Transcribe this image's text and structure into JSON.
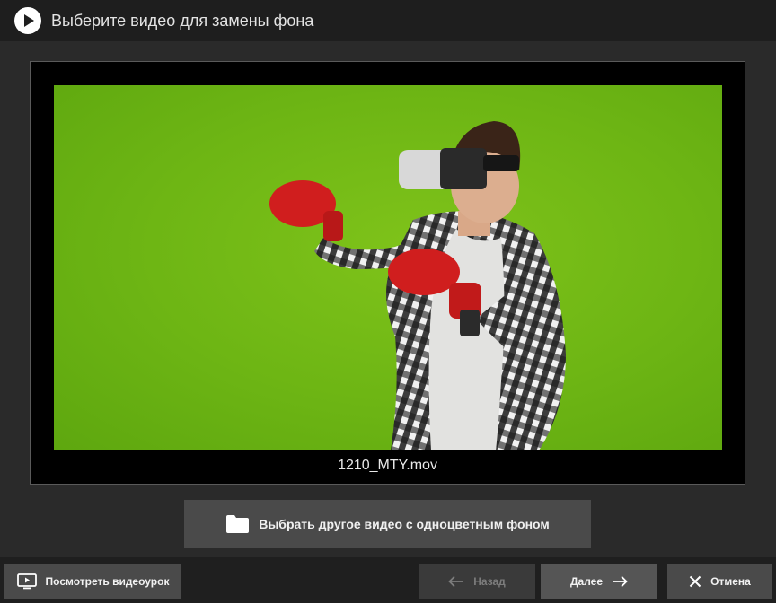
{
  "window": {
    "title": "Выберите видео для замены фона",
    "title_icon": "play-circle-icon"
  },
  "preview": {
    "filename": "1210_MTY.mov",
    "background_color": "#6db514",
    "description_icon": "chroma-key-video-frame"
  },
  "actions": {
    "choose_other_label": "Выбрать другое видео с одноцветным фоном",
    "choose_other_icon": "folder-icon"
  },
  "footer": {
    "tutorial_label": "Посмотреть видеоурок",
    "tutorial_icon": "video-play-icon",
    "back_label": "Назад",
    "back_icon": "arrow-left-icon",
    "next_label": "Далее",
    "next_icon": "arrow-right-icon",
    "cancel_label": "Отмена",
    "cancel_icon": "close-icon"
  }
}
